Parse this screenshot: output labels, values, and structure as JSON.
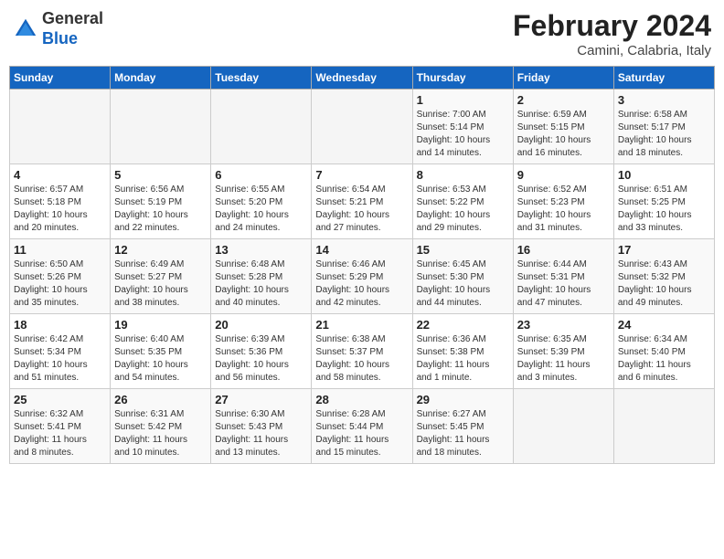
{
  "header": {
    "logo": {
      "line1": "General",
      "line2": "Blue"
    },
    "title": "February 2024",
    "location": "Camini, Calabria, Italy"
  },
  "weekdays": [
    "Sunday",
    "Monday",
    "Tuesday",
    "Wednesday",
    "Thursday",
    "Friday",
    "Saturday"
  ],
  "weeks": [
    [
      {
        "day": "",
        "info": ""
      },
      {
        "day": "",
        "info": ""
      },
      {
        "day": "",
        "info": ""
      },
      {
        "day": "",
        "info": ""
      },
      {
        "day": "1",
        "info": "Sunrise: 7:00 AM\nSunset: 5:14 PM\nDaylight: 10 hours\nand 14 minutes."
      },
      {
        "day": "2",
        "info": "Sunrise: 6:59 AM\nSunset: 5:15 PM\nDaylight: 10 hours\nand 16 minutes."
      },
      {
        "day": "3",
        "info": "Sunrise: 6:58 AM\nSunset: 5:17 PM\nDaylight: 10 hours\nand 18 minutes."
      }
    ],
    [
      {
        "day": "4",
        "info": "Sunrise: 6:57 AM\nSunset: 5:18 PM\nDaylight: 10 hours\nand 20 minutes."
      },
      {
        "day": "5",
        "info": "Sunrise: 6:56 AM\nSunset: 5:19 PM\nDaylight: 10 hours\nand 22 minutes."
      },
      {
        "day": "6",
        "info": "Sunrise: 6:55 AM\nSunset: 5:20 PM\nDaylight: 10 hours\nand 24 minutes."
      },
      {
        "day": "7",
        "info": "Sunrise: 6:54 AM\nSunset: 5:21 PM\nDaylight: 10 hours\nand 27 minutes."
      },
      {
        "day": "8",
        "info": "Sunrise: 6:53 AM\nSunset: 5:22 PM\nDaylight: 10 hours\nand 29 minutes."
      },
      {
        "day": "9",
        "info": "Sunrise: 6:52 AM\nSunset: 5:23 PM\nDaylight: 10 hours\nand 31 minutes."
      },
      {
        "day": "10",
        "info": "Sunrise: 6:51 AM\nSunset: 5:25 PM\nDaylight: 10 hours\nand 33 minutes."
      }
    ],
    [
      {
        "day": "11",
        "info": "Sunrise: 6:50 AM\nSunset: 5:26 PM\nDaylight: 10 hours\nand 35 minutes."
      },
      {
        "day": "12",
        "info": "Sunrise: 6:49 AM\nSunset: 5:27 PM\nDaylight: 10 hours\nand 38 minutes."
      },
      {
        "day": "13",
        "info": "Sunrise: 6:48 AM\nSunset: 5:28 PM\nDaylight: 10 hours\nand 40 minutes."
      },
      {
        "day": "14",
        "info": "Sunrise: 6:46 AM\nSunset: 5:29 PM\nDaylight: 10 hours\nand 42 minutes."
      },
      {
        "day": "15",
        "info": "Sunrise: 6:45 AM\nSunset: 5:30 PM\nDaylight: 10 hours\nand 44 minutes."
      },
      {
        "day": "16",
        "info": "Sunrise: 6:44 AM\nSunset: 5:31 PM\nDaylight: 10 hours\nand 47 minutes."
      },
      {
        "day": "17",
        "info": "Sunrise: 6:43 AM\nSunset: 5:32 PM\nDaylight: 10 hours\nand 49 minutes."
      }
    ],
    [
      {
        "day": "18",
        "info": "Sunrise: 6:42 AM\nSunset: 5:34 PM\nDaylight: 10 hours\nand 51 minutes."
      },
      {
        "day": "19",
        "info": "Sunrise: 6:40 AM\nSunset: 5:35 PM\nDaylight: 10 hours\nand 54 minutes."
      },
      {
        "day": "20",
        "info": "Sunrise: 6:39 AM\nSunset: 5:36 PM\nDaylight: 10 hours\nand 56 minutes."
      },
      {
        "day": "21",
        "info": "Sunrise: 6:38 AM\nSunset: 5:37 PM\nDaylight: 10 hours\nand 58 minutes."
      },
      {
        "day": "22",
        "info": "Sunrise: 6:36 AM\nSunset: 5:38 PM\nDaylight: 11 hours\nand 1 minute."
      },
      {
        "day": "23",
        "info": "Sunrise: 6:35 AM\nSunset: 5:39 PM\nDaylight: 11 hours\nand 3 minutes."
      },
      {
        "day": "24",
        "info": "Sunrise: 6:34 AM\nSunset: 5:40 PM\nDaylight: 11 hours\nand 6 minutes."
      }
    ],
    [
      {
        "day": "25",
        "info": "Sunrise: 6:32 AM\nSunset: 5:41 PM\nDaylight: 11 hours\nand 8 minutes."
      },
      {
        "day": "26",
        "info": "Sunrise: 6:31 AM\nSunset: 5:42 PM\nDaylight: 11 hours\nand 10 minutes."
      },
      {
        "day": "27",
        "info": "Sunrise: 6:30 AM\nSunset: 5:43 PM\nDaylight: 11 hours\nand 13 minutes."
      },
      {
        "day": "28",
        "info": "Sunrise: 6:28 AM\nSunset: 5:44 PM\nDaylight: 11 hours\nand 15 minutes."
      },
      {
        "day": "29",
        "info": "Sunrise: 6:27 AM\nSunset: 5:45 PM\nDaylight: 11 hours\nand 18 minutes."
      },
      {
        "day": "",
        "info": ""
      },
      {
        "day": "",
        "info": ""
      }
    ]
  ]
}
